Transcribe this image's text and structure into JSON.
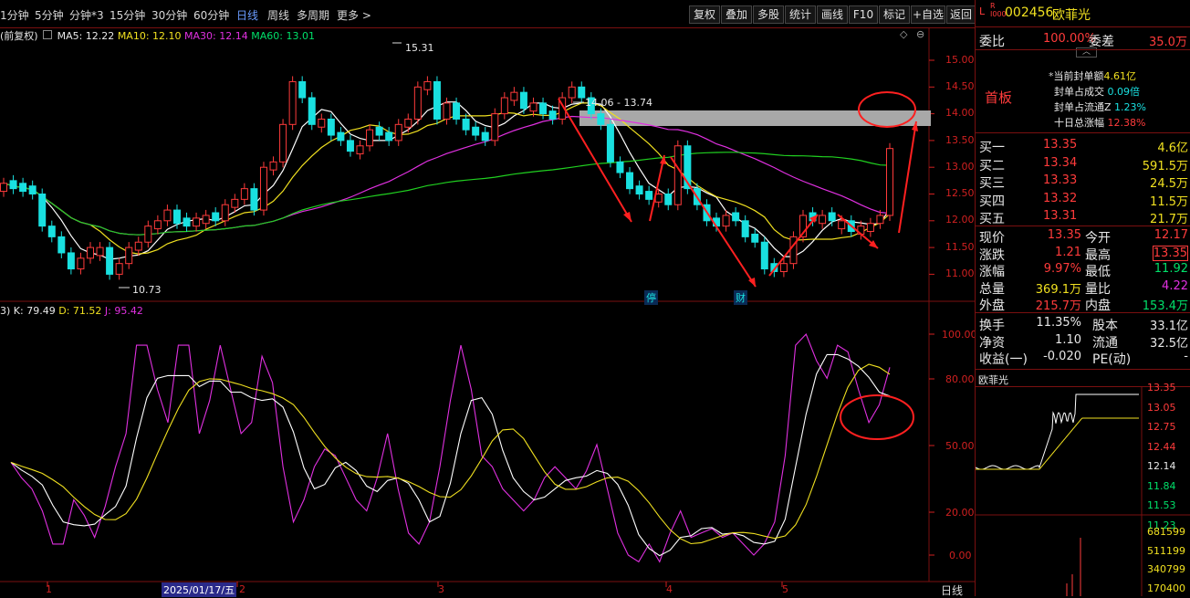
{
  "toolbar": {
    "periods": [
      "1分钟",
      "5分钟",
      "分钟*3",
      "15分钟",
      "30分钟",
      "60分钟",
      "日线",
      "周线",
      "多周期",
      "更多"
    ],
    "active_period": "日线",
    "tools": [
      "复权",
      "叠加",
      "多股",
      "统计",
      "画线",
      "F10",
      "标记",
      "+自选",
      "返回"
    ]
  },
  "main_chart": {
    "legend_prefix": "(前复权)",
    "ma5": "MA5: 12.22",
    "ma10": "MA10: 12.10",
    "ma30": "MA30: 12.14",
    "ma60": "MA60: 13.01",
    "high_label": "15.31",
    "low_label": "10.73",
    "range_label": "14.06 - 13.74",
    "y_ticks": [
      "15.00",
      "14.50",
      "14.00",
      "13.50",
      "13.00",
      "12.50",
      "12.00",
      "11.50",
      "11.00"
    ],
    "markers": [
      "停",
      "财"
    ],
    "colors": {
      "up": "#ff3b3b",
      "down": "#19e0e0",
      "ma5": "#ffffff",
      "ma10": "#f0e020",
      "ma30": "#e030e0",
      "ma60": "#20d020"
    }
  },
  "kdj": {
    "prefix": "3)",
    "k": "K: 79.49",
    "d": "D: 71.52",
    "j": "J: 95.42",
    "y_ticks": [
      "100.00",
      "80.00",
      "50.00",
      "20.00",
      "0.00"
    ]
  },
  "date_axis": {
    "labels": [
      "1",
      "2025/01/17/五",
      "2",
      "3",
      "4",
      "5"
    ],
    "period_label": "日线"
  },
  "stock": {
    "code": "002456",
    "name": "欧菲光",
    "board": "首板",
    "weibi_label": "委比",
    "weibi": "100.00%",
    "weicha_label": "委差",
    "weicha": "35.0万",
    "seal": [
      {
        "label": "当前封单额",
        "value": "4.61亿"
      },
      {
        "label": "封单占成交",
        "value": "0.09倍"
      },
      {
        "label": "封单占流通Z",
        "value": "1.23%"
      },
      {
        "label": "十日总涨幅",
        "value": "12.38%"
      }
    ],
    "bids": [
      {
        "label": "买一",
        "price": "13.35",
        "vol": "4.6亿"
      },
      {
        "label": "买二",
        "price": "13.34",
        "vol": "591.5万"
      },
      {
        "label": "买三",
        "price": "13.33",
        "vol": "24.5万"
      },
      {
        "label": "买四",
        "price": "13.32",
        "vol": "11.5万"
      },
      {
        "label": "买五",
        "price": "13.31",
        "vol": "21.7万"
      }
    ],
    "quote": [
      {
        "l1": "现价",
        "v1": "13.35",
        "l2": "今开",
        "v2": "12.17"
      },
      {
        "l1": "涨跌",
        "v1": "1.21",
        "l2": "最高",
        "v2": "13.35"
      },
      {
        "l1": "涨幅",
        "v1": "9.97%",
        "l2": "最低",
        "v2": "11.92"
      },
      {
        "l1": "总量",
        "v1": "369.1万",
        "l2": "量比",
        "v2": "4.22"
      },
      {
        "l1": "外盘",
        "v1": "215.7万",
        "l2": "内盘",
        "v2": "153.4万"
      }
    ],
    "fin": [
      {
        "l1": "换手",
        "v1": "11.35%",
        "l2": "股本",
        "v2": "33.1亿"
      },
      {
        "l1": "净资",
        "v1": "1.10",
        "l2": "流通",
        "v2": "32.5亿"
      },
      {
        "l1": "收益(一)",
        "v1": "-0.020",
        "l2": "PE(动)",
        "v2": "-"
      }
    ],
    "mini_title": "欧菲光",
    "mini_prices": [
      "13.35",
      "13.05",
      "12.75",
      "12.44",
      "12.14",
      "11.84",
      "11.53",
      "11.23"
    ],
    "mini_vols": [
      "681599",
      "511199",
      "340799",
      "170400"
    ]
  }
}
